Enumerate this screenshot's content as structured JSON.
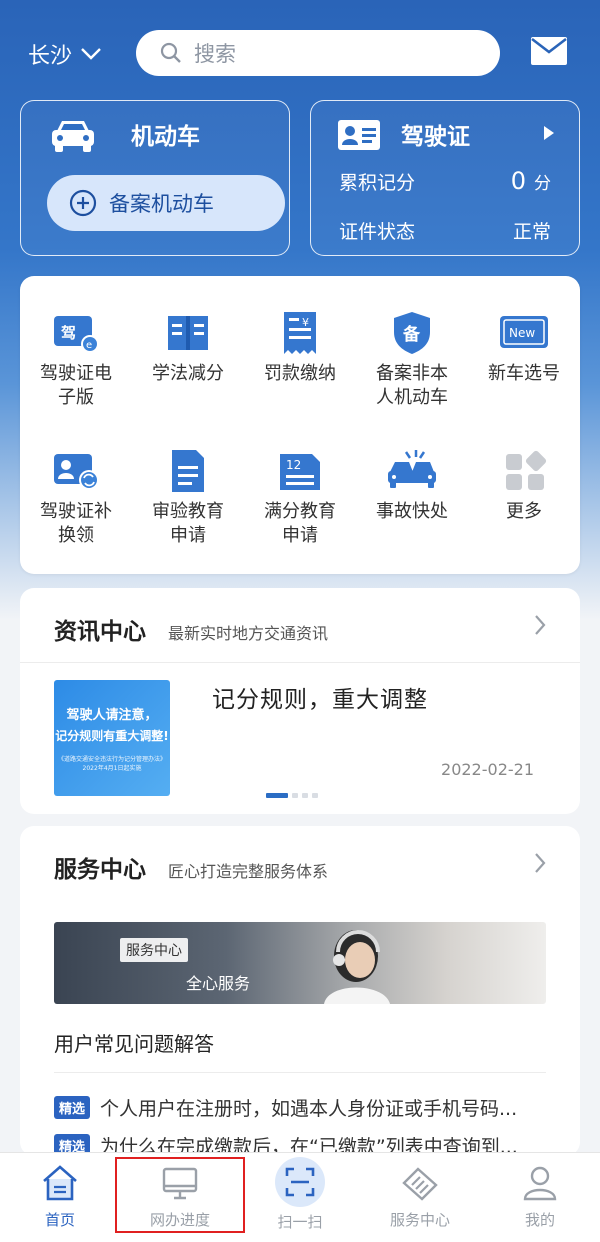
{
  "header": {
    "city": "长沙",
    "search_placeholder": "搜索",
    "colors": {
      "primary": "#2a64b8",
      "accent_light": "#d7e6fb"
    }
  },
  "vehicle_card": {
    "title": "机动车",
    "button_label": "备案机动车"
  },
  "license_card": {
    "title": "驾驶证",
    "points_label": "累积记分",
    "points_value": "0",
    "points_unit": "分",
    "status_label": "证件状态",
    "status_value": "正常"
  },
  "services": [
    {
      "label": "驾驶证电子版",
      "icon": "e-license-icon"
    },
    {
      "label": "学法减分",
      "icon": "book-icon"
    },
    {
      "label": "罚款缴纳",
      "icon": "fine-receipt-icon"
    },
    {
      "label": "备案非本人机动车",
      "icon": "record-shield-icon"
    },
    {
      "label": "新车选号",
      "icon": "new-plate-icon"
    },
    {
      "label": "驾驶证补换领",
      "icon": "license-renew-icon"
    },
    {
      "label": "审验教育申请",
      "icon": "document-icon"
    },
    {
      "label": "满分教育申请",
      "icon": "calendar-12-icon"
    },
    {
      "label": "事故快处",
      "icon": "accident-icon"
    },
    {
      "label": "更多",
      "icon": "more-grid-icon"
    }
  ],
  "news": {
    "title": "资讯中心",
    "subtitle": "最新实时地方交通资讯",
    "article_title": "记分规则，重大调整",
    "article_date": "2022-02-21",
    "image_line1": "驾驶人请注意，",
    "image_line2": "记分规则有重大调整!",
    "image_line3": "《道路交通安全违法行为记分管理办法》 2022年4月1日起实施"
  },
  "service_center": {
    "title": "服务中心",
    "subtitle": "匠心打造完整服务体系",
    "banner_tag": "服务中心",
    "banner_text": "全心服务",
    "faq_title": "用户常见问题解答",
    "faq_badge": "精选",
    "faq": [
      "个人用户在注册时，如遇本人身份证或手机号码...",
      "为什么在完成缴款后，在“已缴款”列表中查询到..."
    ]
  },
  "tabbar": {
    "tabs": [
      {
        "label": "首页"
      },
      {
        "label": "网办进度"
      },
      {
        "label": "扫一扫"
      },
      {
        "label": "服务中心"
      },
      {
        "label": "我的"
      }
    ]
  }
}
